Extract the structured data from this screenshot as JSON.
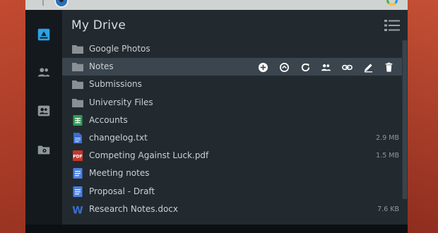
{
  "app": {
    "title": "My Drive"
  },
  "colors": {
    "accent": "#2aa3e6",
    "folder": "#8a9196",
    "sheet": "#2e9e4f",
    "pdf": "#c8362b",
    "doc": "#4a7ee0",
    "word": "#3b6ecc"
  },
  "sidebar": {
    "items": [
      {
        "icon": "drive-icon",
        "active": true
      },
      {
        "icon": "shared-people-icon"
      },
      {
        "icon": "contacts-icon"
      },
      {
        "icon": "folder-settings-icon"
      }
    ]
  },
  "file_actions": [
    "add-icon",
    "sync-folder-icon",
    "refresh-icon",
    "share-people-icon",
    "link-icon",
    "rename-pencil-icon",
    "delete-trash-icon"
  ],
  "files": [
    {
      "name": "Google Photos",
      "type": "folder",
      "size": ""
    },
    {
      "name": "Notes",
      "type": "folder",
      "size": "",
      "selected": true
    },
    {
      "name": "Submissions",
      "type": "folder",
      "size": ""
    },
    {
      "name": "University Files",
      "type": "folder",
      "size": ""
    },
    {
      "name": "Accounts",
      "type": "sheet",
      "size": ""
    },
    {
      "name": "changelog.txt",
      "type": "text",
      "size": "2.9 MB"
    },
    {
      "name": "Competing Against Luck.pdf",
      "type": "pdf",
      "size": "1.5 MB"
    },
    {
      "name": "Meeting notes",
      "type": "doc",
      "size": ""
    },
    {
      "name": "Proposal - Draft",
      "type": "doc",
      "size": ""
    },
    {
      "name": "Research Notes.docx",
      "type": "word",
      "size": "7.6 KB"
    }
  ]
}
